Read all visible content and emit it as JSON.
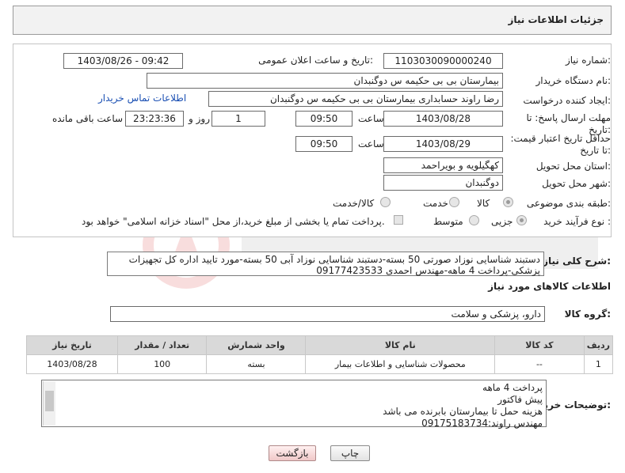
{
  "header": {
    "title": "جزئیات اطلاعات نیاز"
  },
  "form": {
    "need_number_label": "شماره نیاز:",
    "need_number": "1103030090000240",
    "announce_label": "تاریخ و ساعت اعلان عمومی:",
    "announce_value": "1403/08/26 - 09:42",
    "buyer_org_label": "نام دستگاه خریدار:",
    "buyer_org": "بیمارستان بی بی حکیمه س  دوگنبدان",
    "creator_label": "ایجاد کننده درخواست:",
    "creator": "رضا راوند حسابداری بیمارستان بی بی حکیمه س  دوگنبدان",
    "contact_link": "اطلاعات تماس خریدار",
    "deadline_label": "مهلت ارسال پاسخ: تا تاریخ:",
    "deadline_date": "1403/08/28",
    "time_label": "ساعت",
    "deadline_time": "09:50",
    "days_value": "1",
    "days_label": "روز و",
    "remaining_time": "23:23:36",
    "remaining_label": "ساعت باقی مانده",
    "validity_label": "حداقل تاریخ اعتبار قیمت: تا تاریخ:",
    "validity_date": "1403/08/29",
    "validity_time": "09:50",
    "province_label": "استان محل تحویل:",
    "province": "کهگیلویه و بویراحمد",
    "city_label": "شهر محل تحویل:",
    "city": "دوگنبدان",
    "category_label": "طبقه بندی موضوعی:",
    "category_options": [
      "کالا",
      "خدمت",
      "کالا/خدمت"
    ],
    "purchase_type_label": "نوع فرآیند خرید :",
    "purchase_options": [
      "جزیی",
      "متوسط"
    ],
    "treasury_note": "پرداخت تمام یا بخشی از مبلغ خرید،از محل \"اسناد خزانه اسلامی\" خواهد بود."
  },
  "description": {
    "label": "شرح کلی نیاز:",
    "text": "دستبند شناسایی نوزاد صورتی 50 بسته-دستبند شناسایی نوزاد آبی 50 بسته-مورد تایید اداره کل تجهیزات پزشکی-پرداخت 4 ماهه-مهندس احمدی 09177423533"
  },
  "goods_info": {
    "heading": "اطلاعات کالاهای مورد نیاز",
    "group_label": "گروه کالا:",
    "group_value": "دارو، پزشکی و سلامت"
  },
  "table": {
    "headers": [
      "ردیف",
      "کد کالا",
      "نام کالا",
      "واحد شمارش",
      "تعداد / مقدار",
      "تاریخ نیاز"
    ],
    "rows": [
      [
        "1",
        "--",
        "محصولات شناسایی و اطلاعات بیمار",
        "بسته",
        "100",
        "1403/08/28"
      ]
    ]
  },
  "buyer_notes": {
    "label": "توضیحات خریدار:",
    "lines": [
      "پرداخت 4 ماهه",
      "پیش فاکتور",
      "هزینه حمل تا بیمارستان بابرنده می باشد",
      "مهندس راوند:09175183734"
    ]
  },
  "buttons": {
    "print": "چاپ",
    "back": "بازگشت"
  },
  "colors": {
    "link": "#1a4fb3",
    "header_bg": "#f2f2f2",
    "table_header_bg": "#d9d9d9"
  }
}
